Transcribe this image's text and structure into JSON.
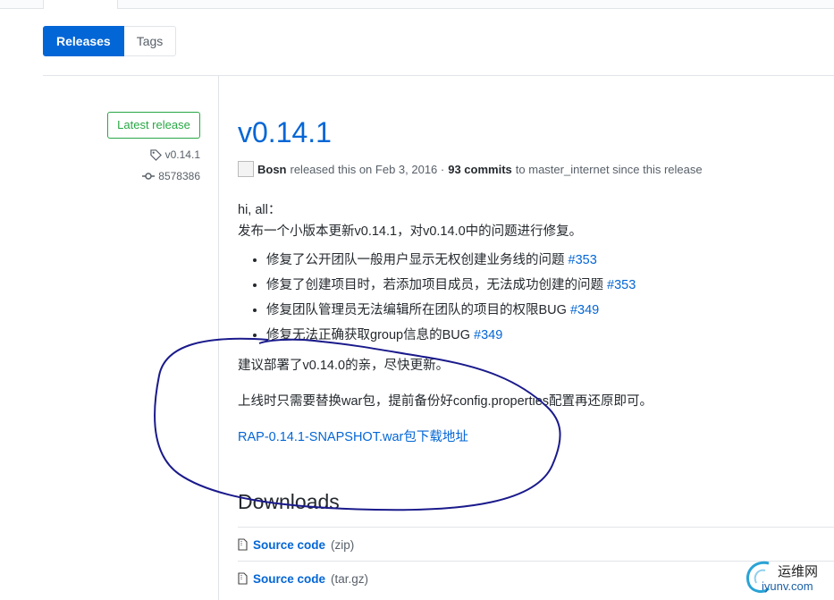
{
  "nav": {
    "releases_label": "Releases",
    "tags_label": "Tags"
  },
  "sidebar": {
    "latest_label": "Latest release",
    "tag": "v0.14.1",
    "commit": "8578386"
  },
  "release": {
    "title": "v0.14.1",
    "author": "Bosn",
    "released_text": "released this on Feb 3, 2016 ·",
    "commits": "93 commits",
    "commits_suffix": "to master_internet since this release",
    "greeting": "hi, all：",
    "intro": "发布一个小版本更新v0.14.1，对v0.14.0中的问题进行修复。",
    "items": [
      {
        "text": "修复了公开团队一般用户显示无权创建业务线的问题",
        "issue": "#353"
      },
      {
        "text": "修复了创建项目时，若添加项目成员，无法成功创建的问题",
        "issue": "#353"
      },
      {
        "text": "修复团队管理员无法编辑所在团队的项目的权限BUG",
        "issue": "#349"
      },
      {
        "text": "修复无法正确获取group信息的BUG",
        "issue": "#349"
      }
    ],
    "advice": "建议部署了v0.14.0的亲，尽快更新。",
    "note": "上线时只需要替换war包，提前备份好config.properties配置再还原即可。",
    "download_link": "RAP-0.14.1-SNAPSHOT.war包下载地址"
  },
  "downloads": {
    "heading": "Downloads",
    "files": [
      {
        "name": "Source code",
        "format": "(zip)"
      },
      {
        "name": "Source code",
        "format": "(tar.gz)"
      }
    ]
  },
  "watermark": {
    "line1": "运维网",
    "line2": "iyunv.com"
  },
  "colors": {
    "accent": "#0366d6",
    "green": "#28a745",
    "annotation": "#1a1a8c"
  }
}
